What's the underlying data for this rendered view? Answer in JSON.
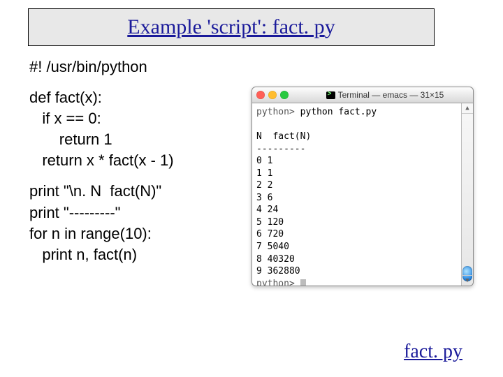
{
  "title": {
    "part1": "Example 'script': fact. p",
    "part2": "y"
  },
  "code": [
    "#! /usr/bin/python",
    "def fact(x):",
    "   if x == 0:",
    "       return 1",
    "   return x * fact(x - 1)",
    "print \"\\n. N  fact(N)\"",
    "print \"---------\"",
    "for n in range(10):",
    "   print n, fact(n)"
  ],
  "terminal": {
    "title": "Terminal — emacs — 31×15",
    "prompt": "python>",
    "cmd": "python fact.py",
    "header": "N  fact(N)",
    "divider": "---------",
    "rows": [
      "0 1",
      "1 1",
      "2 2",
      "3 6",
      "4 24",
      "5 120",
      "6 720",
      "7 5040",
      "8 40320",
      "9 362880"
    ]
  },
  "footer": {
    "link": "fact. py"
  }
}
